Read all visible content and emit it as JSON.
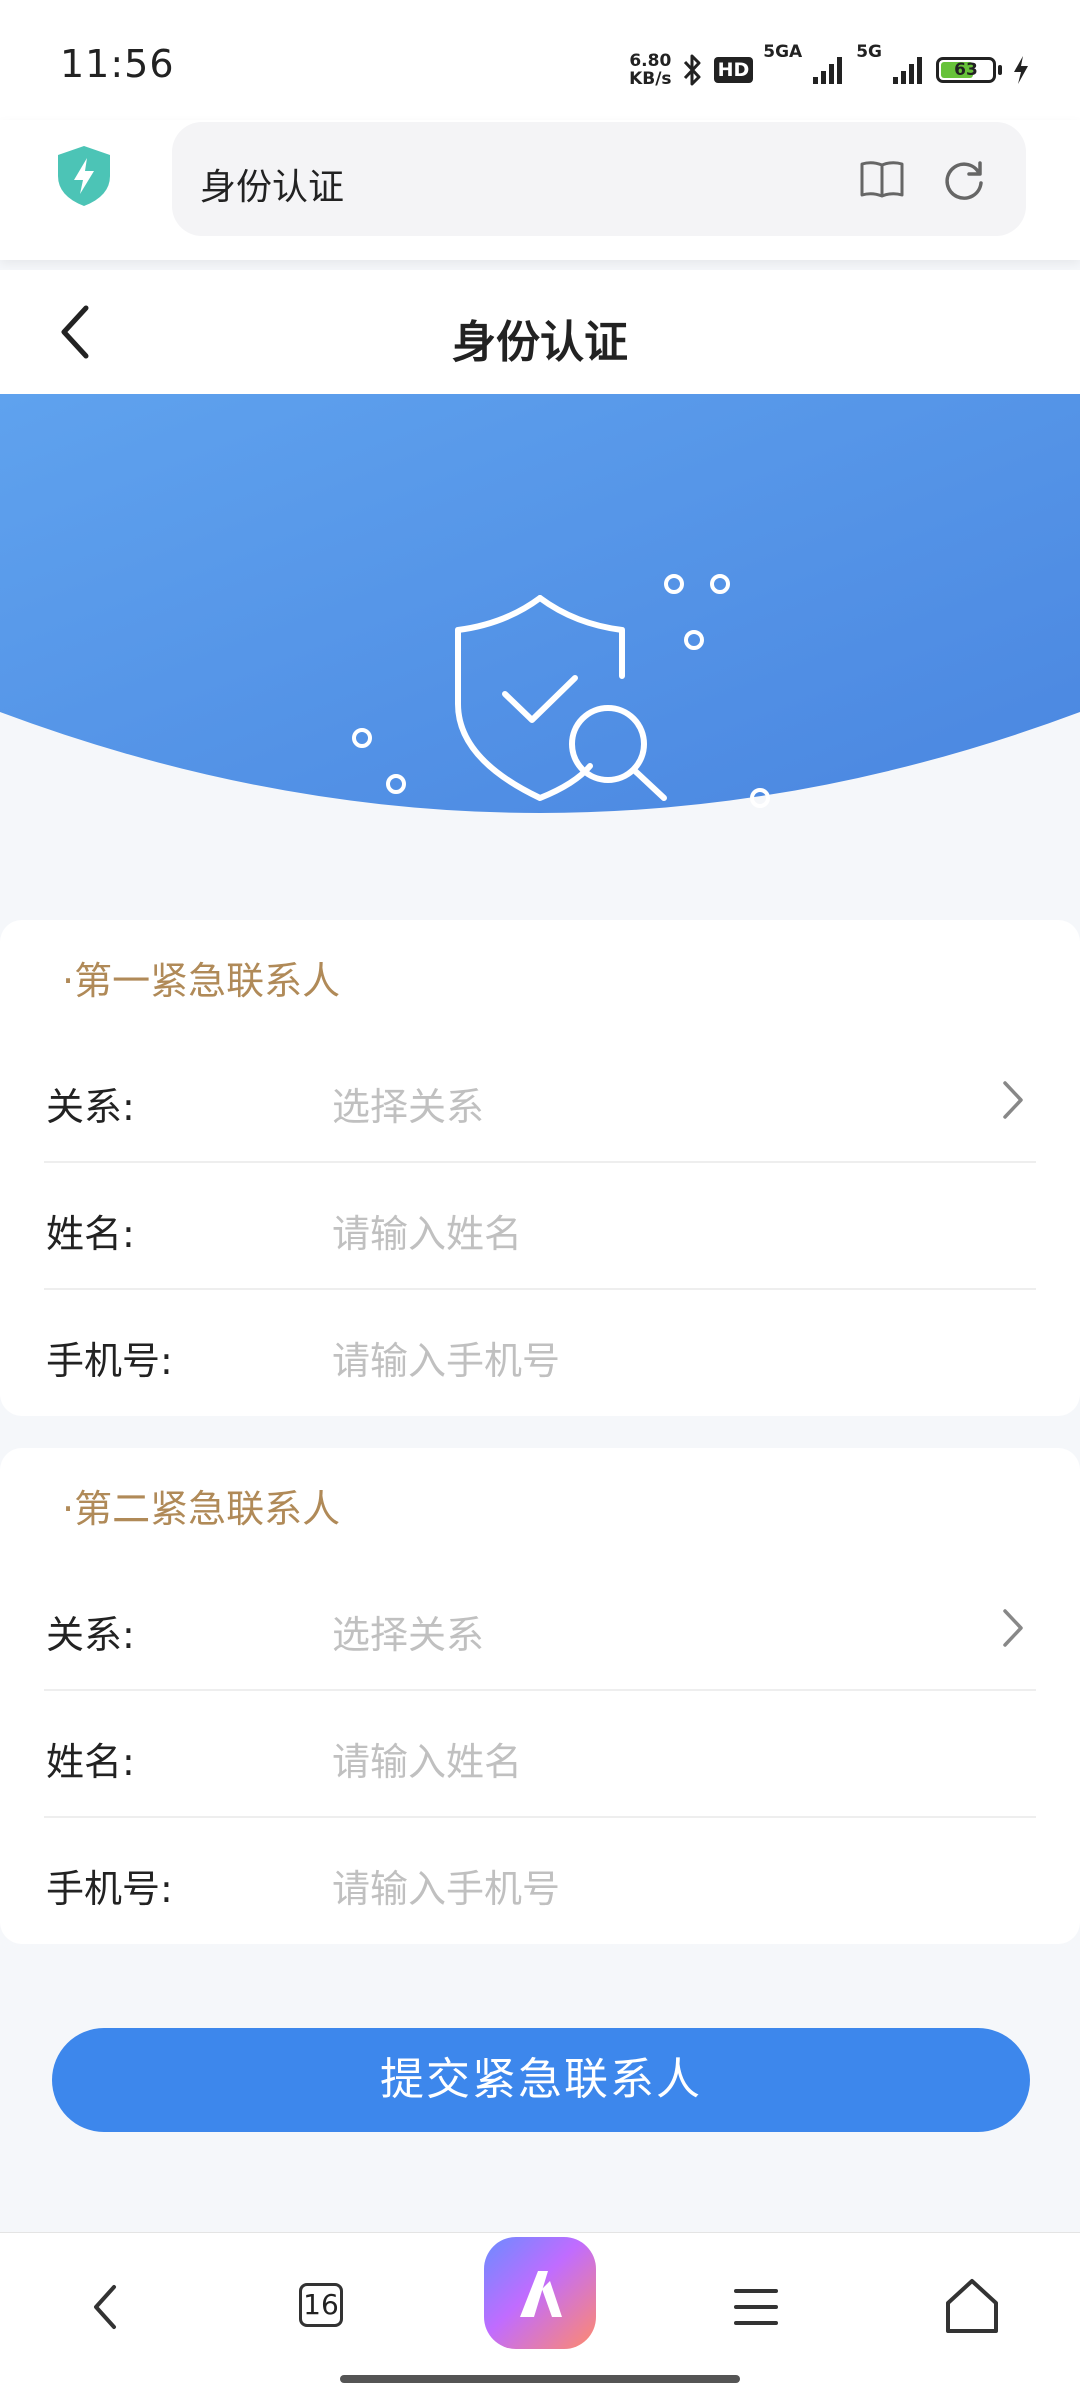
{
  "status_bar": {
    "time": "11:56",
    "net_speed_value": "6.80",
    "net_speed_unit": "KB/s",
    "hd_label": "HD",
    "signal1_label": "5GA",
    "signal2_label": "5G",
    "battery_percent": "63"
  },
  "browser": {
    "url_text": "身份认证"
  },
  "header": {
    "title": "身份认证"
  },
  "section1": {
    "title": "·第一紧急联系人",
    "relation_label": "关系:",
    "relation_placeholder": "选择关系",
    "name_label": "姓名:",
    "name_placeholder": "请输入姓名",
    "phone_label": "手机号:",
    "phone_placeholder": "请输入手机号"
  },
  "section2": {
    "title": "·第二紧急联系人",
    "relation_label": "关系:",
    "relation_placeholder": "选择关系",
    "name_label": "姓名:",
    "name_placeholder": "请输入姓名",
    "phone_label": "手机号:",
    "phone_placeholder": "请输入手机号"
  },
  "submit_label": "提交紧急联系人",
  "bottom_nav": {
    "tab_count": "16"
  },
  "colors": {
    "accent": "#3d87ec",
    "section_title": "#b08a58",
    "hero_gradient_start": "#5fa2ee",
    "hero_gradient_end": "#4a86e0"
  },
  "icons": {
    "browser_logo": "shield-bolt-icon",
    "reader": "book-icon",
    "refresh": "refresh-icon",
    "back": "chevron-left-icon",
    "select": "chevron-right-icon",
    "hero": "shield-check-search-icon",
    "nav_back": "chevron-left-icon",
    "nav_tabs": "tabs-icon",
    "nav_app": "app-logo-icon",
    "nav_menu": "menu-icon",
    "nav_home": "home-icon"
  }
}
